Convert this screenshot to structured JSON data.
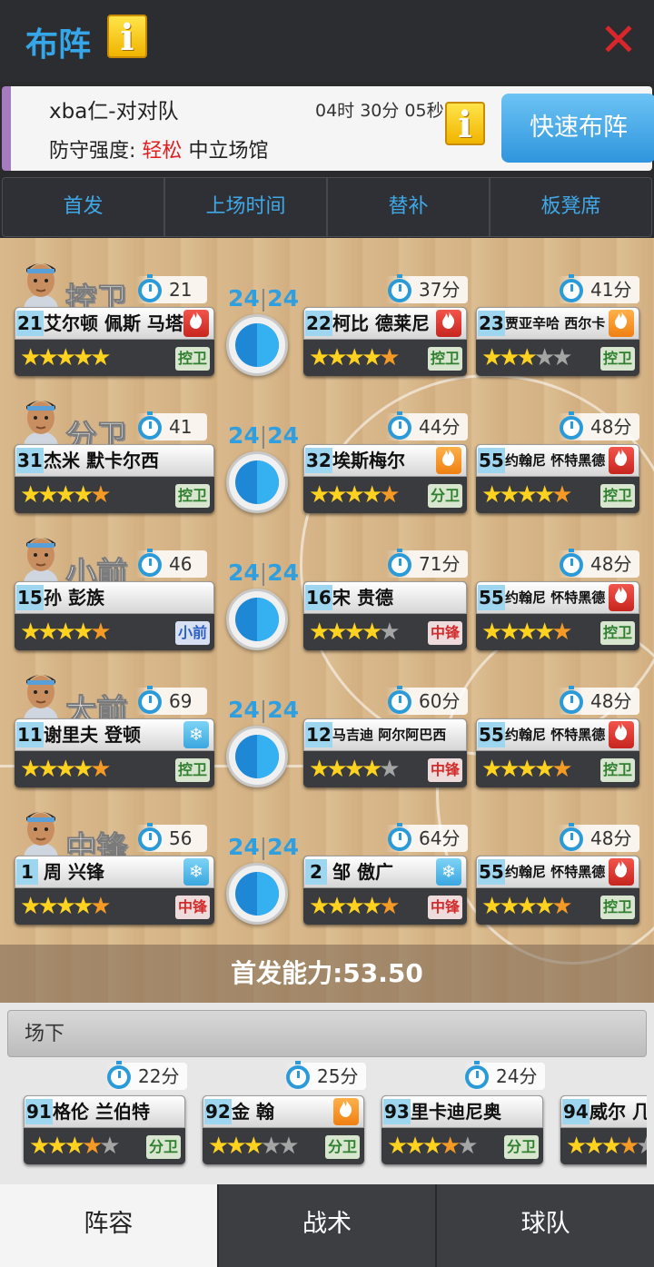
{
  "header": {
    "title": "布阵",
    "info_icon": "i",
    "close_icon": "✕"
  },
  "match": {
    "team": "xba仁-对对队",
    "countdown": "04时 30分 05秒",
    "defense_label": "防守强度:",
    "defense_value": "轻松",
    "venue": "中立场馆",
    "quick_button": "快速布阵"
  },
  "top_tabs": [
    "首发",
    "上场时间",
    "替补",
    "板凳席"
  ],
  "rows": [
    {
      "pos": "控卫",
      "score_a": "24",
      "score_b": "24",
      "starter": {
        "mins": "21分",
        "num": "21",
        "name": "艾尔顿 佩斯  马塔",
        "small": false,
        "badge": "fire",
        "stars": "fffff-h",
        "tag": "控卫",
        "tagc": "green"
      },
      "sub": {
        "mins": "37分",
        "num": "22",
        "name": "柯比 德莱尼",
        "small": false,
        "badge": "fire",
        "stars": "ffffh",
        "tag": "控卫",
        "tagc": "green"
      },
      "bench": {
        "mins": "41分",
        "num": "23",
        "name": "贾亚辛哈 西尔卡",
        "small": true,
        "badge": "fire2",
        "stars": "fffee",
        "tag": "控卫",
        "tagc": "green"
      }
    },
    {
      "pos": "分卫",
      "score_a": "24",
      "score_b": "24",
      "starter": {
        "mins": "41分",
        "num": "31",
        "name": "杰米 默卡尔西",
        "small": false,
        "badge": "",
        "stars": "ffffh",
        "tag": "控卫",
        "tagc": "green"
      },
      "sub": {
        "mins": "44分",
        "num": "32",
        "name": "埃斯梅尔",
        "small": false,
        "badge": "fire2",
        "stars": "ffffh",
        "tag": "分卫",
        "tagc": "green"
      },
      "bench": {
        "mins": "48分",
        "num": "55",
        "name": "约翰尼 怀特黑德",
        "small": true,
        "badge": "fire",
        "stars": "ffffh",
        "tag": "控卫",
        "tagc": "green"
      }
    },
    {
      "pos": "小前",
      "score_a": "24",
      "score_b": "24",
      "starter": {
        "mins": "46分",
        "num": "15",
        "name": "孙 彭族",
        "small": false,
        "badge": "",
        "stars": "ffffh",
        "tag": "小前",
        "tagc": "blue"
      },
      "sub": {
        "mins": "71分",
        "num": "16",
        "name": "宋 贵德",
        "small": false,
        "badge": "",
        "stars": "ffffe",
        "tag": "中锋",
        "tagc": "red"
      },
      "bench": {
        "mins": "48分",
        "num": "55",
        "name": "约翰尼 怀特黑德",
        "small": true,
        "badge": "fire",
        "stars": "ffffh",
        "tag": "控卫",
        "tagc": "green"
      }
    },
    {
      "pos": "大前",
      "score_a": "24",
      "score_b": "24",
      "starter": {
        "mins": "69分",
        "num": "11",
        "name": "谢里夫 登顿",
        "small": false,
        "badge": "ice",
        "stars": "ffffh",
        "tag": "控卫",
        "tagc": "green"
      },
      "sub": {
        "mins": "60分",
        "num": "12",
        "name": "马吉迪 阿尔阿巴西",
        "small": true,
        "badge": "",
        "stars": "ffffe",
        "tag": "中锋",
        "tagc": "red"
      },
      "bench": {
        "mins": "48分",
        "num": "55",
        "name": "约翰尼 怀特黑德",
        "small": true,
        "badge": "fire",
        "stars": "ffffh",
        "tag": "控卫",
        "tagc": "green"
      }
    },
    {
      "pos": "中锋",
      "score_a": "24",
      "score_b": "24",
      "starter": {
        "mins": "56分",
        "num": "1",
        "name": "周 兴锋",
        "small": false,
        "badge": "ice",
        "stars": "ffffh",
        "tag": "中锋",
        "tagc": "red"
      },
      "sub": {
        "mins": "64分",
        "num": "2",
        "name": "邹 傲广",
        "small": false,
        "badge": "ice",
        "stars": "ffffh",
        "tag": "中锋",
        "tagc": "red"
      },
      "bench": {
        "mins": "48分",
        "num": "55",
        "name": "约翰尼 怀特黑德",
        "small": true,
        "badge": "fire",
        "stars": "ffffh",
        "tag": "控卫",
        "tagc": "green"
      }
    }
  ],
  "power": "首发能力:53.50",
  "bench": {
    "title": "场下",
    "players": [
      {
        "mins": "22分",
        "num": "91",
        "name": "格伦 兰伯特",
        "small": false,
        "badge": "",
        "stars": "fffhe",
        "tag": "分卫",
        "tagc": "green"
      },
      {
        "mins": "25分",
        "num": "92",
        "name": "金 翰",
        "small": false,
        "badge": "fire2",
        "stars": "fffee",
        "tag": "分卫",
        "tagc": "green"
      },
      {
        "mins": "24分",
        "num": "93",
        "name": "里卡迪尼奥",
        "small": false,
        "badge": "",
        "stars": "fffhe",
        "tag": "分卫",
        "tagc": "green"
      },
      {
        "mins": "",
        "num": "94",
        "name": "威尔 几",
        "small": false,
        "badge": "",
        "stars": "fffhe",
        "tag": "",
        "tagc": "green"
      }
    ]
  },
  "bottom_tabs": [
    "阵容",
    "战术",
    "球队"
  ]
}
